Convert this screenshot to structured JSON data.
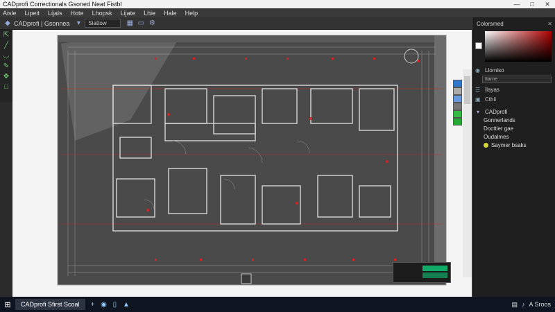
{
  "window": {
    "title": "CADprofi Correctionals Gsoned Neat Fistbl"
  },
  "menu": [
    "Aisle",
    "Lipeit",
    "Lijals",
    "Hote",
    "Lhopsk",
    "Lijate",
    "Lhie",
    "Hale",
    "Help"
  ],
  "toolbar": {
    "doc_label": "CADprofi | Gsonnea",
    "field_value": "Siattow"
  },
  "right_panel": {
    "header": "Colorsmed",
    "section_a": "Llomiso",
    "field_placeholder": "Itarne",
    "row_b": "Ilayas",
    "row_c": "Cthii",
    "layers": [
      {
        "label": "CADprofi",
        "sub": false
      },
      {
        "label": "Gonnerlands",
        "sub": true
      },
      {
        "label": "Docttier gae",
        "sub": true
      },
      {
        "label": "Oudalmes",
        "sub": true
      },
      {
        "label": "Saymer bsaks",
        "sub": true
      }
    ]
  },
  "taskbar": {
    "app": "CADprofi Sfirst Scoal",
    "tray_text": "A Sroos"
  },
  "colors": {
    "accent_red": "#e02020",
    "cad_bg": "#4a4a4a"
  }
}
